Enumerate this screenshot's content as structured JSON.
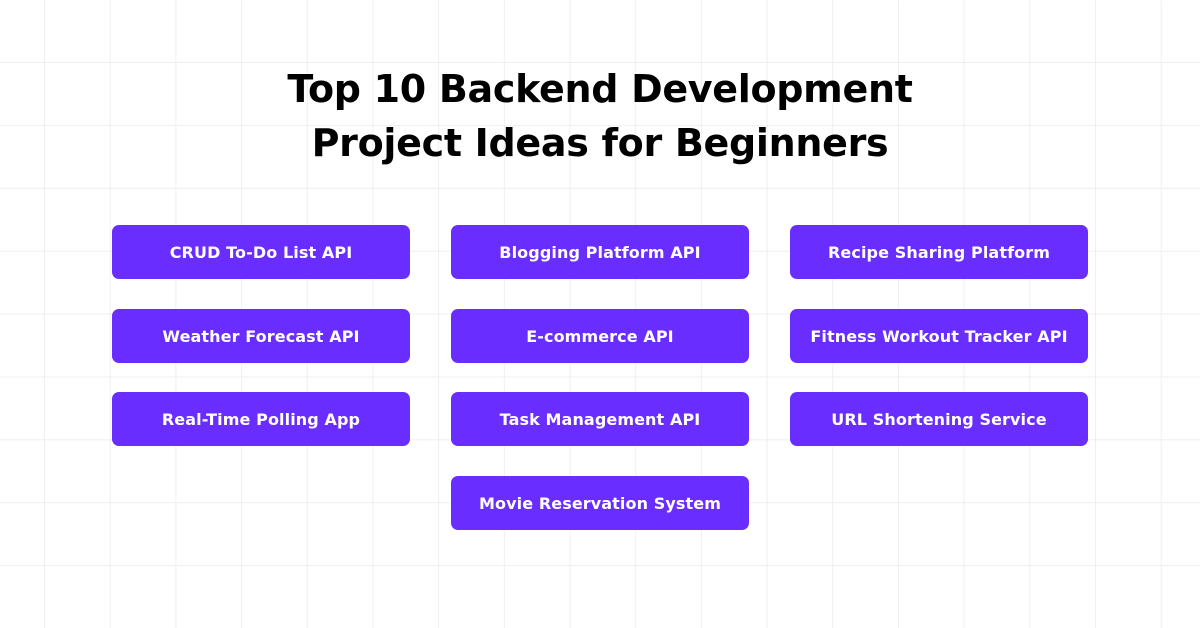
{
  "header": {
    "title_line1": "Top 10 Backend Development",
    "title_line2": "Project Ideas for Beginners"
  },
  "theme": {
    "accent": "#6A2DFF",
    "card_text": "#FFFFFF",
    "title_color": "#000000",
    "background": "#FFFFFF",
    "grid_line": "#EFEFEF"
  },
  "projects": [
    {
      "label": "CRUD To-Do List API"
    },
    {
      "label": "Blogging Platform API"
    },
    {
      "label": "Recipe Sharing Platform"
    },
    {
      "label": "Weather Forecast API"
    },
    {
      "label": "E-commerce API"
    },
    {
      "label": "Fitness Workout Tracker API"
    },
    {
      "label": "Real-Time Polling App"
    },
    {
      "label": "Task Management API"
    },
    {
      "label": "URL Shortening Service"
    },
    {
      "label": "Movie Reservation System"
    }
  ]
}
